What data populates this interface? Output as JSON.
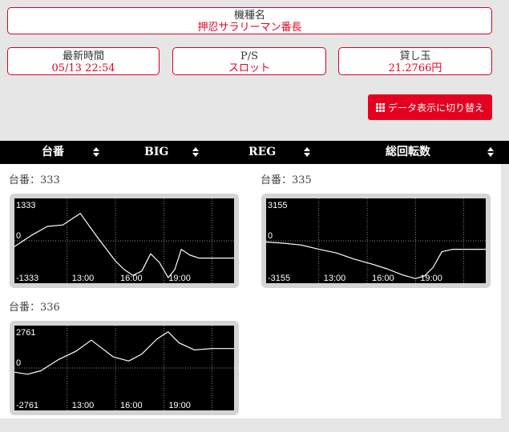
{
  "machine": {
    "label": "機種名",
    "value": "押忍サラリーマン番長"
  },
  "stats": [
    {
      "label": "最新時間",
      "value": "05/13 22:54"
    },
    {
      "label": "P/S",
      "value": "スロット"
    },
    {
      "label": "貸し玉",
      "value": "21.2766円"
    }
  ],
  "toggle_button": {
    "label": "データ表示に切り替え",
    "icon": "grid-icon"
  },
  "table_header": {
    "columns": [
      "台番",
      "BIG",
      "REG",
      "総回転数"
    ]
  },
  "colors": {
    "accent": "#e60020",
    "header_bg": "#000000",
    "chart_bg": "#000000",
    "line": "#ffffff"
  },
  "units": [
    {
      "title": "台番：333"
    },
    {
      "title": "台番：335"
    },
    {
      "title": "台番：336"
    }
  ],
  "chart_data": [
    {
      "type": "line",
      "ymax_label": "1333",
      "zero_label": "0",
      "ymin_label": "-1333",
      "ylim": [
        -1333,
        1333
      ],
      "xtick_labels": [
        "13:00",
        "16:00",
        "19:00"
      ],
      "x": [
        0,
        0.08,
        0.15,
        0.22,
        0.3,
        0.38,
        0.46,
        0.5,
        0.54,
        0.58,
        0.62,
        0.66,
        0.7,
        0.73,
        0.76,
        0.8,
        0.84,
        0.9,
        1.0
      ],
      "y": [
        -200,
        200,
        500,
        550,
        950,
        100,
        -700,
        -1000,
        -1200,
        -1050,
        -450,
        -750,
        -1280,
        -1000,
        -300,
        -500,
        -600,
        -600,
        -600
      ]
    },
    {
      "type": "line",
      "ymax_label": "3155",
      "zero_label": "0",
      "ymin_label": "-3155",
      "ylim": [
        -3155,
        3155
      ],
      "xtick_labels": [
        "13:00",
        "16:00",
        "19:00"
      ],
      "x": [
        0,
        0.08,
        0.16,
        0.24,
        0.32,
        0.4,
        0.48,
        0.55,
        0.62,
        0.68,
        0.72,
        0.76,
        0.8,
        0.85,
        0.9,
        1.0
      ],
      "y": [
        -100,
        -200,
        -350,
        -700,
        -1000,
        -1500,
        -1900,
        -2300,
        -2800,
        -3100,
        -2900,
        -2200,
        -900,
        -700,
        -700,
        -700
      ]
    },
    {
      "type": "line",
      "ymax_label": "2761",
      "zero_label": "0",
      "ymin_label": "-2761",
      "ylim": [
        -2761,
        2761
      ],
      "xtick_labels": [
        "13:00",
        "16:00",
        "19:00"
      ],
      "x": [
        0,
        0.06,
        0.12,
        0.2,
        0.28,
        0.35,
        0.4,
        0.45,
        0.52,
        0.58,
        0.65,
        0.7,
        0.75,
        0.82,
        0.9,
        1.0
      ],
      "y": [
        -300,
        -450,
        -200,
        600,
        1200,
        2000,
        1400,
        800,
        500,
        1000,
        2100,
        2600,
        1800,
        1300,
        1400,
        1400
      ]
    }
  ]
}
